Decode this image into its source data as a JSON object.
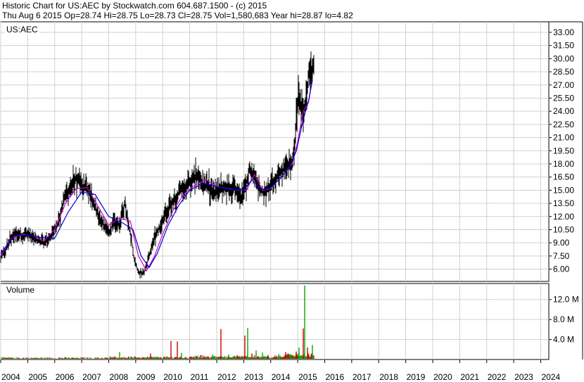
{
  "header": {
    "line1": "Historic Chart for US:AEC by Stockwatch.com 604.687.1500 - (c) 2015",
    "line2": "Thu Aug  6 2015  Op=28.74  Hi=28.75  Lo=28.73  Cl=28.75  Vol=1,580,683  Year hi=28.87  lo=4.82"
  },
  "colors": {
    "price_bars": "#000000",
    "ma_short": "#cc00cc",
    "ma_long": "#0000cc",
    "volume_up": "#00aa00",
    "volume_down": "#cc0000",
    "grid": "#d0d0d0"
  },
  "chart_data": [
    {
      "type": "line",
      "label": "US:AEC",
      "y_ticks": [
        "33.00",
        "31.50",
        "30.00",
        "28.50",
        "27.00",
        "25.50",
        "24.00",
        "22.50",
        "21.00",
        "19.50",
        "18.00",
        "16.50",
        "15.00",
        "13.50",
        "12.00",
        "10.50",
        "9.00",
        "7.50",
        "6.00"
      ],
      "ylim": [
        4.6,
        34.2
      ],
      "x_ticks": [
        "2004",
        "2005",
        "2006",
        "2007",
        "2008",
        "2009",
        "2010",
        "2011",
        "2012",
        "2013",
        "2014",
        "2015",
        "2016",
        "2017",
        "2018",
        "2019",
        "2020",
        "2021",
        "2022",
        "2023",
        "2024"
      ],
      "xlim": [
        2004.0,
        2024.3
      ],
      "grid": true,
      "series": [
        {
          "x": [
            2004.0,
            2004.2,
            2004.4,
            2004.6,
            2004.8,
            2005.0,
            2005.3,
            2005.6,
            2005.9,
            2006.2,
            2006.4,
            2006.6,
            2006.8,
            2007.0,
            2007.2,
            2007.4,
            2007.6,
            2007.8,
            2008.0,
            2008.2,
            2008.4,
            2008.6,
            2008.8,
            2008.95,
            2009.1,
            2009.3,
            2009.5,
            2009.7,
            2009.9,
            2010.1,
            2010.3,
            2010.5,
            2010.7,
            2010.9,
            2011.1,
            2011.3,
            2011.5,
            2011.7,
            2011.9,
            2012.1,
            2012.3,
            2012.5,
            2012.7,
            2012.9,
            2013.0,
            2013.2,
            2013.4,
            2013.6,
            2013.8,
            2014.0,
            2014.2,
            2014.4,
            2014.6,
            2014.8,
            2014.9,
            2015.0,
            2015.1,
            2015.2,
            2015.3,
            2015.4,
            2015.55,
            2015.6
          ],
          "values": [
            7.3,
            8.3,
            9.7,
            10.1,
            9.9,
            10.0,
            9.3,
            9.0,
            9.9,
            12.0,
            14.5,
            15.4,
            16.4,
            15.3,
            15.2,
            14.0,
            12.2,
            11.0,
            10.2,
            11.3,
            11.1,
            13.5,
            10.2,
            7.0,
            5.7,
            5.5,
            7.5,
            9.6,
            10.9,
            12.3,
            13.5,
            14.3,
            15.1,
            15.6,
            16.0,
            16.9,
            15.5,
            15.4,
            14.6,
            15.0,
            15.4,
            15.1,
            15.3,
            14.3,
            14.5,
            17.3,
            16.8,
            14.9,
            14.8,
            15.6,
            16.6,
            17.1,
            18.0,
            17.8,
            21.0,
            25.3,
            24.8,
            24.1,
            24.6,
            28.6,
            28.8,
            28.75
          ]
        },
        {
          "x": [
            2004.0,
            2004.4,
            2004.8,
            2005.2,
            2005.6,
            2006.0,
            2006.4,
            2006.8,
            2007.2,
            2007.6,
            2008.0,
            2008.4,
            2008.8,
            2009.1,
            2009.4,
            2009.7,
            2010.0,
            2010.4,
            2010.8,
            2011.2,
            2011.6,
            2012.0,
            2012.4,
            2012.8,
            2013.1,
            2013.4,
            2013.7,
            2014.0,
            2014.4,
            2014.8,
            2015.0,
            2015.2,
            2015.4,
            2015.55
          ],
          "values": [
            7.5,
            9.5,
            10.0,
            9.8,
            9.2,
            10.5,
            13.5,
            15.2,
            15.3,
            13.2,
            11.0,
            11.8,
            11.5,
            7.5,
            5.8,
            7.5,
            10.0,
            12.8,
            14.6,
            15.6,
            16.2,
            15.4,
            15.2,
            15.0,
            15.0,
            16.8,
            15.0,
            15.2,
            16.6,
            18.0,
            20.5,
            24.0,
            25.0,
            27.8
          ]
        },
        {
          "x": [
            2004.0,
            2004.5,
            2005.0,
            2005.5,
            2006.0,
            2006.5,
            2007.0,
            2007.5,
            2008.0,
            2008.5,
            2008.9,
            2009.2,
            2009.5,
            2009.8,
            2010.2,
            2010.6,
            2011.0,
            2011.5,
            2012.0,
            2012.5,
            2013.0,
            2013.3,
            2013.6,
            2013.9,
            2014.3,
            2014.7,
            2014.95,
            2015.2,
            2015.4,
            2015.55
          ],
          "values": [
            7.8,
            9.8,
            9.9,
            9.6,
            9.5,
            12.5,
            14.8,
            14.5,
            12.0,
            11.3,
            10.5,
            7.5,
            6.2,
            7.8,
            11.0,
            13.3,
            15.0,
            15.8,
            15.4,
            15.1,
            15.0,
            16.2,
            15.2,
            15.0,
            16.2,
            17.6,
            19.5,
            23.0,
            25.2,
            27.6
          ]
        }
      ]
    },
    {
      "type": "bar",
      "label": "Volume",
      "y_ticks": [
        "12.0 M",
        "8.0 M",
        "4.0 M"
      ],
      "ylim": [
        0,
        15.2
      ],
      "y_unit": "M",
      "xlim": [
        2004.0,
        2024.3
      ],
      "grid": true,
      "spikes": [
        {
          "x": 2009.55,
          "value": 1.2,
          "dir": "down"
        },
        {
          "x": 2008.4,
          "value": 1.5,
          "dir": "up"
        },
        {
          "x": 2010.3,
          "value": 3.7,
          "dir": "down"
        },
        {
          "x": 2010.55,
          "value": 3.6,
          "dir": "down"
        },
        {
          "x": 2010.7,
          "value": 1.3,
          "dir": "up"
        },
        {
          "x": 2011.4,
          "value": 0.9,
          "dir": "down"
        },
        {
          "x": 2011.85,
          "value": 1.0,
          "dir": "up"
        },
        {
          "x": 2012.15,
          "value": 6.1,
          "dir": "down"
        },
        {
          "x": 2012.45,
          "value": 1.0,
          "dir": "up"
        },
        {
          "x": 2012.75,
          "value": 0.8,
          "dir": "down"
        },
        {
          "x": 2013.05,
          "value": 4.8,
          "dir": "down"
        },
        {
          "x": 2013.15,
          "value": 6.3,
          "dir": "up"
        },
        {
          "x": 2013.3,
          "value": 1.2,
          "dir": "down"
        },
        {
          "x": 2013.45,
          "value": 1.8,
          "dir": "up"
        },
        {
          "x": 2013.7,
          "value": 1.4,
          "dir": "up"
        },
        {
          "x": 2013.9,
          "value": 0.9,
          "dir": "down"
        },
        {
          "x": 2014.3,
          "value": 1.1,
          "dir": "up"
        },
        {
          "x": 2014.55,
          "value": 1.5,
          "dir": "down"
        },
        {
          "x": 2014.75,
          "value": 1.0,
          "dir": "up"
        },
        {
          "x": 2014.95,
          "value": 1.6,
          "dir": "down"
        },
        {
          "x": 2015.05,
          "value": 2.4,
          "dir": "up"
        },
        {
          "x": 2015.2,
          "value": 6.2,
          "dir": "down"
        },
        {
          "x": 2015.25,
          "value": 14.8,
          "dir": "up"
        },
        {
          "x": 2015.35,
          "value": 2.4,
          "dir": "down"
        },
        {
          "x": 2015.55,
          "value": 2.9,
          "dir": "up"
        }
      ]
    }
  ]
}
